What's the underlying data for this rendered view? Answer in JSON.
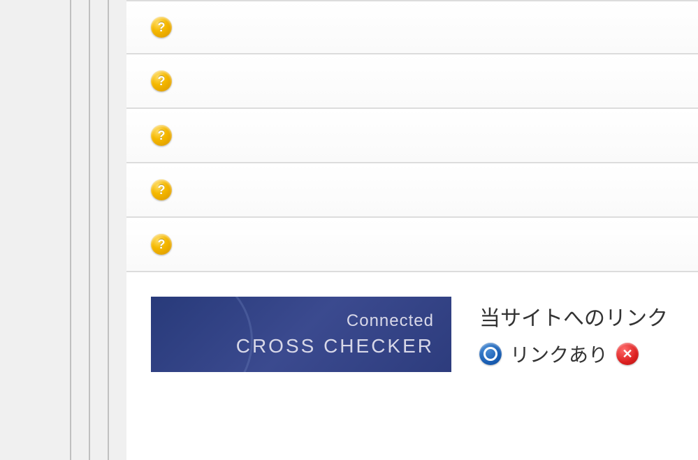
{
  "list": {
    "items": [
      {
        "icon": "question"
      },
      {
        "icon": "question"
      },
      {
        "icon": "question"
      },
      {
        "icon": "question"
      },
      {
        "icon": "question"
      }
    ]
  },
  "banner": {
    "line1": "Connected",
    "line2": "CROSS CHECKER"
  },
  "linkStatus": {
    "title": "当サイトへのリンク",
    "hasLink": "リンクあり"
  }
}
